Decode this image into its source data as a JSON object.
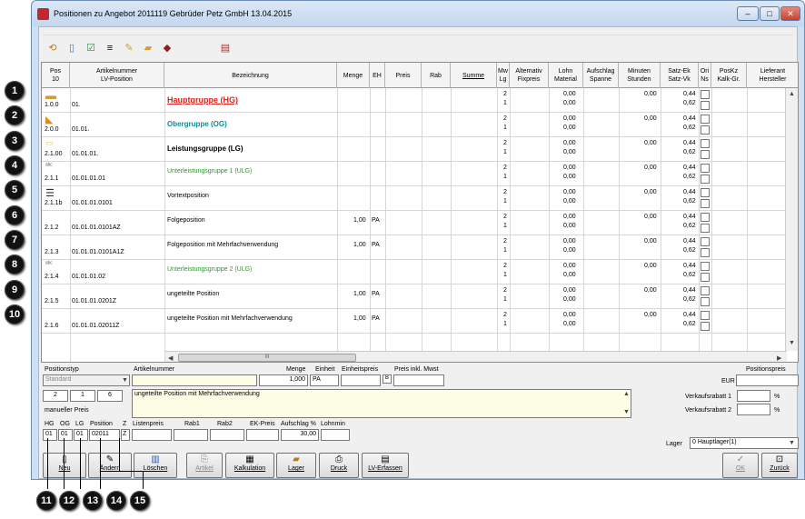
{
  "window": {
    "title": "Positionen zu Angebot 2011119 Gebrüder Petz GmbH 13.04.2015",
    "minimize": "–",
    "maximize": "□",
    "close": "✕"
  },
  "toolbar": {
    "icons": [
      "undo-icon",
      "document-icon",
      "checklist-icon",
      "text-icon",
      "edit-icon",
      "folder-icon",
      "stamp-icon",
      "print-preview-icon"
    ]
  },
  "grid": {
    "headers": {
      "pos": "Pos\n10",
      "artnr": "Artikelnummer\nLV-Position",
      "bez": "Bezeichnung",
      "menge": "Menge",
      "eh": "EH",
      "preis": "Preis",
      "rab": "Rab",
      "summe": "Summe",
      "mw": "Mw\nLg",
      "alt": "Alternativ\nFixpreis",
      "lohn": "Lohn\nMaterial",
      "aufschlag": "Aufschlag\nSpanne",
      "minuten": "Minuten\nStunden",
      "satz": "Satz-Ek\nSatz-Vk",
      "ori": "Ori\nNs",
      "poskz": "PosKz\nKalk-Gr.",
      "lieferant": "Lieferant\nHersteller"
    },
    "rows": [
      {
        "pos": "1.0.0",
        "art": "01.",
        "bez": "Hauptgruppe (HG)",
        "menge": "",
        "eh": "",
        "mw1": "2",
        "mw2": "1",
        "lohn1": "0,00",
        "lohn2": "0,00",
        "min1": "0,00",
        "satz1": "0,44",
        "satz2": "0,62"
      },
      {
        "pos": "2.0.0",
        "art": "01.01.",
        "bez": "Obergruppe (OG)",
        "menge": "",
        "eh": "",
        "mw1": "2",
        "mw2": "1",
        "lohn1": "0,00",
        "lohn2": "0,00",
        "min1": "0,00",
        "satz1": "0,44",
        "satz2": "0,62"
      },
      {
        "pos": "2.1.00",
        "art": "01.01.01.",
        "bez": "Leistungsgruppe (LG)",
        "menge": "",
        "eh": "",
        "mw1": "2",
        "mw2": "1",
        "lohn1": "0,00",
        "lohn2": "0,00",
        "min1": "0,00",
        "satz1": "0,44",
        "satz2": "0,62"
      },
      {
        "pos": "2.1.1",
        "art": "01.01.01.01",
        "bez": "Unterleistungsgruppe 1 (ULG)",
        "menge": "",
        "eh": "",
        "mw1": "2",
        "mw2": "1",
        "lohn1": "0,00",
        "lohn2": "0,00",
        "min1": "0,00",
        "satz1": "0,44",
        "satz2": "0,62"
      },
      {
        "pos": "2.1.1b",
        "art": "01.01.01.0101",
        "bez": "Vortextposition",
        "menge": "",
        "eh": "",
        "mw1": "2",
        "mw2": "1",
        "lohn1": "0,00",
        "lohn2": "0,00",
        "min1": "0,00",
        "satz1": "0,44",
        "satz2": "0,62"
      },
      {
        "pos": "2.1.2",
        "art": "01.01.01.0101AZ",
        "bez": "Folgeposition",
        "menge": "1,00",
        "eh": "PA",
        "mw1": "2",
        "mw2": "1",
        "lohn1": "0,00",
        "lohn2": "0,00",
        "min1": "0,00",
        "satz1": "0,44",
        "satz2": "0,62"
      },
      {
        "pos": "2.1.3",
        "art": "01.01.01.0101A1Z",
        "bez": "Folgeposition mit Mehrfachverwendung",
        "menge": "1,00",
        "eh": "PA",
        "mw1": "2",
        "mw2": "1",
        "lohn1": "0,00",
        "lohn2": "0,00",
        "min1": "0,00",
        "satz1": "0,44",
        "satz2": "0,62"
      },
      {
        "pos": "2.1.4",
        "art": "01.01.01.02",
        "bez": "Unterleistungsgruppe 2 (ULG)",
        "menge": "",
        "eh": "",
        "mw1": "2",
        "mw2": "1",
        "lohn1": "0,00",
        "lohn2": "0,00",
        "min1": "0,00",
        "satz1": "0,44",
        "satz2": "0,62"
      },
      {
        "pos": "2.1.5",
        "art": "01.01.01.0201Z",
        "bez": "ungeteilte Position",
        "menge": "1,00",
        "eh": "PA",
        "mw1": "2",
        "mw2": "1",
        "lohn1": "0,00",
        "lohn2": "0,00",
        "min1": "0,00",
        "satz1": "0,44",
        "satz2": "0,62"
      },
      {
        "pos": "2.1.6",
        "art": "01.01.01.02011Z",
        "bez": "ungeteilte Position mit Mehrfachverwendung",
        "menge": "1,00",
        "eh": "PA",
        "mw1": "2",
        "mw2": "1",
        "lohn1": "0,00",
        "lohn2": "0,00",
        "min1": "0,00",
        "satz1": "0,44",
        "satz2": "0,62"
      }
    ],
    "row_colors": [
      "#e0201b",
      "#138c8c",
      "#000000",
      "#2a9a2a",
      "#000000",
      "#000000",
      "#000000",
      "#2a9a2a",
      "#000000",
      "#000000"
    ],
    "row_icons": [
      "folder-closed-icon",
      "folder-open-icon",
      "folder-small-icon",
      "ulg-icon",
      "vortext-icon",
      "",
      "",
      "ulg-icon",
      "",
      ""
    ],
    "scroll_thumb": "III"
  },
  "detail": {
    "positionstyp_label": "Positionstyp",
    "positionstyp_value": "Standard",
    "artikelnummer_label": "Artikelnummer",
    "menge_label": "Menge",
    "menge_value": "1,000",
    "einheit_label": "Einheit",
    "einheit_value": "PA",
    "einheitspreis_label": "Einheitspreis",
    "preis_inkl_label": "Preis inkl. Mwst",
    "positionspreis_label": "Positionspreis",
    "eur_label": "EUR",
    "num1": "2",
    "num2": "1",
    "num3": "6",
    "manueller_preis": "manueller Preis",
    "beschreibung": "ungeteilte Position mit Mehrfachverwendung",
    "vk_rabatt1_label": "Verkaufsrabatt 1",
    "vk_rabatt2_label": "Verkaufsrabatt 2",
    "percent": "%",
    "hg_label": "HG",
    "og_label": "OG",
    "lg_label": "LG",
    "position_label": "Position",
    "z_label": "Z",
    "hg_value": "01",
    "og_value": "01",
    "lg_value": "01",
    "position_value": "02011",
    "z_value": "Z",
    "listenpreis_label": "Listenpreis",
    "rab1_label": "Rab1",
    "rab2_label": "Rab2",
    "ekpreis_label": "EK-Preis",
    "aufschlag_label": "Aufschlag %",
    "lohnmin_label": "Lohnmin",
    "aufschlag_value": "30,00",
    "lager_label": "Lager",
    "lager_value": "0        Hauptlager(1)"
  },
  "buttons": {
    "neu": "Neu",
    "aendern": "Ändern",
    "loeschen": "Löschen",
    "artikel": "Artikel",
    "kalkulation": "Kalkulation",
    "lager": "Lager",
    "druck": "Druck",
    "lverfassen": "LV-Erfassen",
    "ok": "OK",
    "zurueck": "Zurück"
  },
  "markers": [
    "1",
    "2",
    "3",
    "4",
    "5",
    "6",
    "7",
    "8",
    "9",
    "10",
    "11",
    "12",
    "13",
    "14",
    "15"
  ]
}
